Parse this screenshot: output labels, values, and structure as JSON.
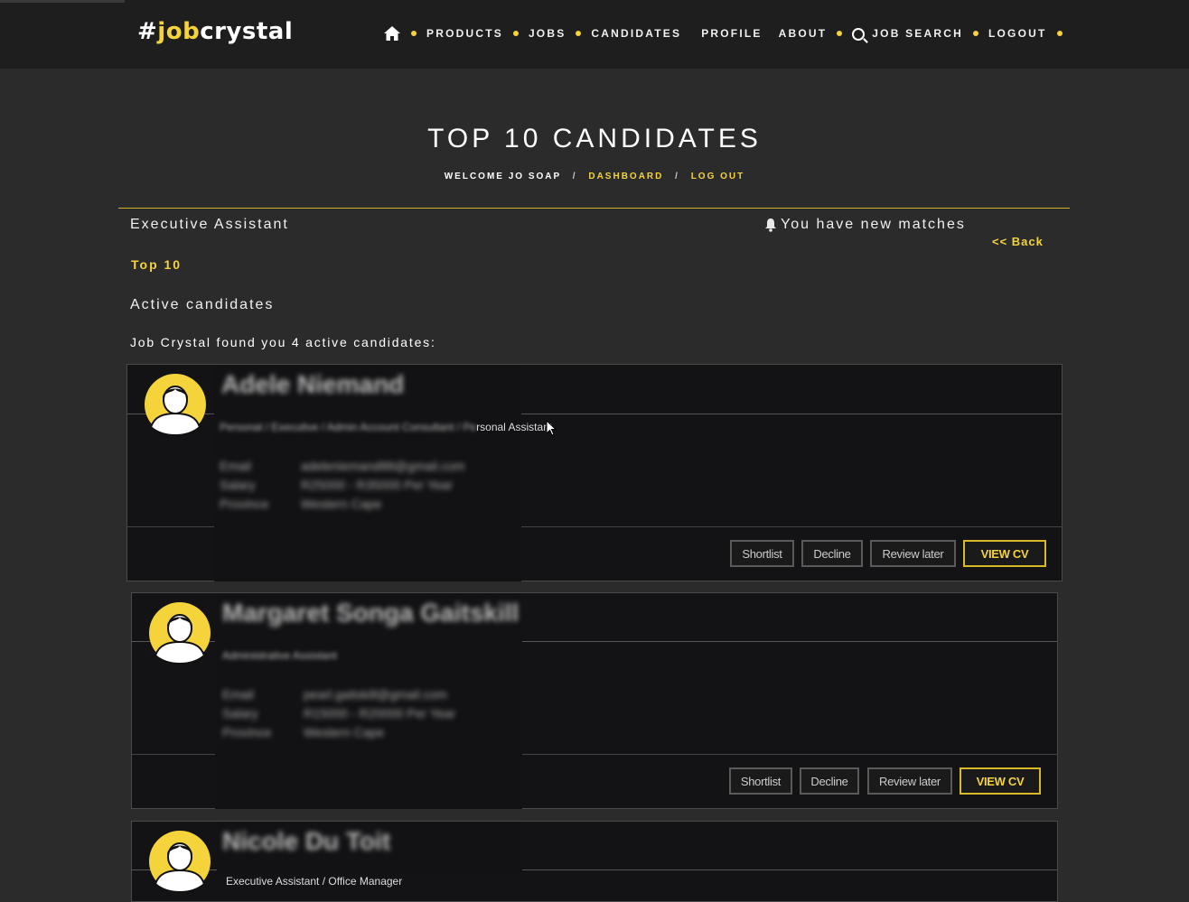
{
  "brand": {
    "hash": "#",
    "job": "job",
    "crystal": "crystal"
  },
  "nav": {
    "products": "PRODUCTS",
    "jobs": "JOBS",
    "candidates": "CANDIDATES",
    "profile": "PROFILE",
    "about": "ABOUT",
    "job_search": "JOB SEARCH",
    "logout": "LOGOUT"
  },
  "page": {
    "title": "TOP 10 CANDIDATES",
    "welcome": "WELCOME JO SOAP",
    "sep": "/",
    "dashboard": "DASHBOARD",
    "logout": "LOG OUT"
  },
  "job": {
    "title": "Executive Assistant",
    "matches": "You have new matches",
    "back": "<< Back",
    "top10": "Top 10",
    "active_heading": "Active candidates",
    "found_text": "Job Crystal found you 4 active candidates:"
  },
  "buttons": {
    "shortlist": "Shortlist",
    "decline": "Decline",
    "review": "Review later",
    "view_cv": "VIEW CV"
  },
  "candidates": [
    {
      "name": "Adele Niemand",
      "subtitle_blur": "Personal / Executive / Admin Account Consultant / Pe",
      "subtitle_clear": "rsonal Assistant",
      "email_label": "Email",
      "email": "adeleniemand88@gmail.com",
      "salary_label": "Salary",
      "salary": "R25000 - R35000 Per Year",
      "province_label": "Province",
      "province": "Western Cape"
    },
    {
      "name": "Margaret Songa Gaitskill",
      "subtitle_blur": "Administrative Assistant",
      "subtitle_clear": "",
      "email_label": "Email",
      "email": "pearl.gaitskill@gmail.com",
      "salary_label": "Salary",
      "salary": "R15000 - R20000 Per Year",
      "province_label": "Province",
      "province": "Western Cape"
    },
    {
      "name": "Nicole Du Toit",
      "subtitle_blur": "",
      "subtitle_clear": "Executive Assistant / Office Manager"
    }
  ],
  "colors": {
    "accent": "#f5d33b",
    "bg": "#2b2b2b",
    "topbar": "#1e1e1e"
  }
}
